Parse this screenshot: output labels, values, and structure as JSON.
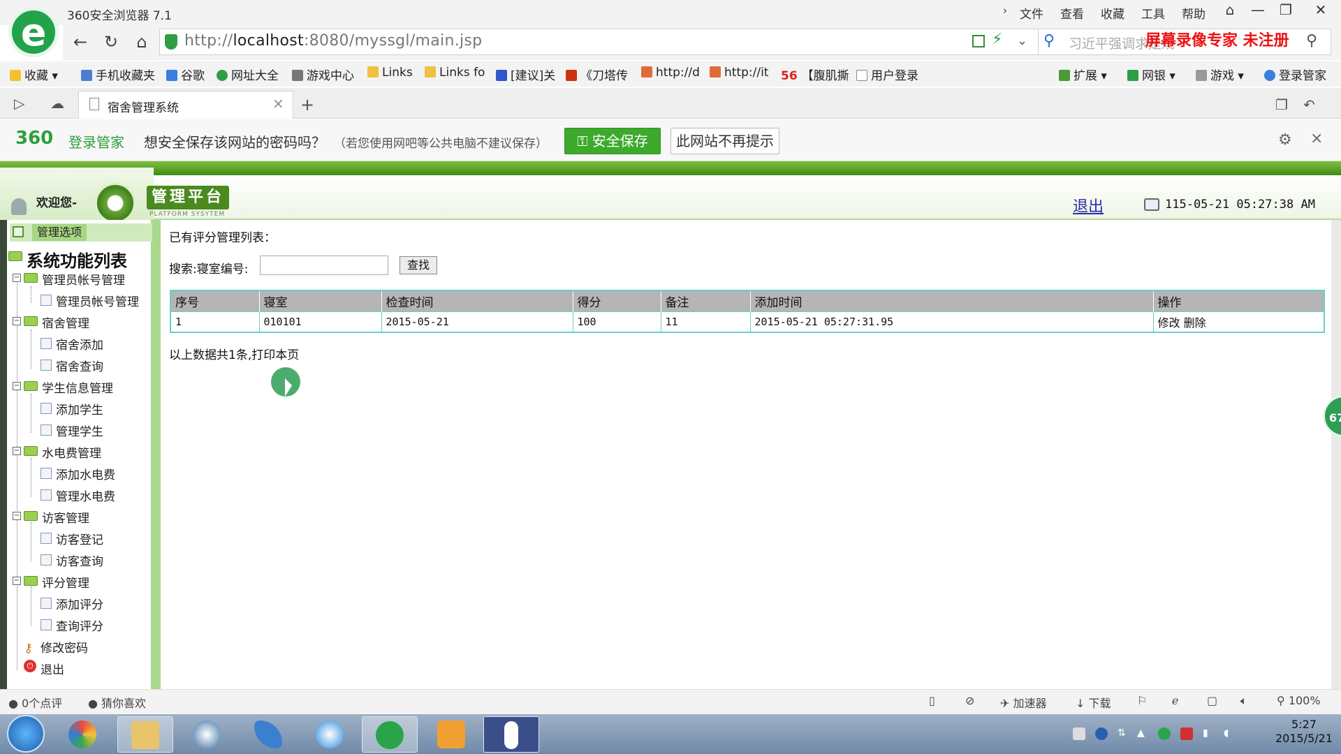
{
  "browser": {
    "app_title": "360安全浏览器 7.1",
    "menu": [
      "文件",
      "查看",
      "收藏",
      "工具",
      "帮助"
    ],
    "url_scheme": "http://",
    "url_host": "localhost",
    "url_path": ":8080/myssgl/main.jsp",
    "search_placeholder": "习近平强调求是规",
    "watermark": "屏幕录像专家  未注册"
  },
  "bookmarks": {
    "items": [
      "收藏",
      "手机收藏夹",
      "谷歌",
      "网址大全",
      "游戏中心",
      "Links",
      "Links fo",
      "[建议]关",
      "《刀塔传",
      "http://d",
      "http://it",
      "【腹肌撕",
      "用户登录"
    ],
    "right_items": [
      "扩展",
      "网银",
      "游戏",
      "登录管家"
    ],
    "item_56": "56"
  },
  "tab": {
    "title": "宿舍管理系统",
    "close": "×",
    "new": "+"
  },
  "password_bar": {
    "brand": "360",
    "brand_sub": "登录管家",
    "question": "想安全保存该网站的密码吗？",
    "note": "（若您使用网吧等公共电脑不建议保存）",
    "save_label": "安全保存",
    "never_label": "此网站不再提示",
    "close": "×"
  },
  "app_header": {
    "welcome": "欢迎您-",
    "platform_title": "管理平台",
    "platform_sub": "PLATFORM SYSYTEM",
    "logout": "退出",
    "datetime": "115-05-21 05:27:38 AM"
  },
  "sidebar": {
    "header_label": "管理选项",
    "root": "系统功能列表",
    "expander": "−",
    "categories": [
      {
        "label": "管理员帐号管理",
        "items": [
          "管理员帐号管理"
        ]
      },
      {
        "label": "宿舍管理",
        "items": [
          "宿舍添加",
          "宿舍查询"
        ]
      },
      {
        "label": "学生信息管理",
        "items": [
          "添加学生",
          "管理学生"
        ]
      },
      {
        "label": "水电费管理",
        "items": [
          "添加水电费",
          "管理水电费"
        ]
      },
      {
        "label": "访客管理",
        "items": [
          "访客登记",
          "访客查询"
        ]
      },
      {
        "label": "评分管理",
        "items": [
          "添加评分",
          "查询评分"
        ]
      }
    ],
    "extra": [
      "修改密码",
      "退出"
    ]
  },
  "main": {
    "list_title": "已有评分管理列表：",
    "search_label": "搜索:寝室编号:",
    "search_value": "",
    "search_button": "查找",
    "columns": [
      "序号",
      "寝室",
      "检查时间",
      "得分",
      "备注",
      "添加时间",
      "操作"
    ],
    "rows": [
      {
        "index": "1",
        "room": "010101",
        "check_time": "2015-05-21",
        "score": "100",
        "remark": "11",
        "added": "2015-05-21 05:27:31.95",
        "edit": "修改",
        "delete": "删除"
      }
    ],
    "summary": "以上数据共1条,打印本页",
    "side_badge": "67"
  },
  "statusbar": {
    "left": [
      "0个点评",
      "猜你喜欢"
    ],
    "right": [
      "加速器",
      "下载",
      "100%"
    ]
  },
  "taskbar": {
    "time": "5:27",
    "date": "2015/5/21"
  },
  "colors": {
    "accent_green": "#3daa2c",
    "sidebar_border": "#a9d98f",
    "table_border": "#66d0c8",
    "header_gray": "#b5b5b5",
    "watermark_red": "#ee1111"
  }
}
